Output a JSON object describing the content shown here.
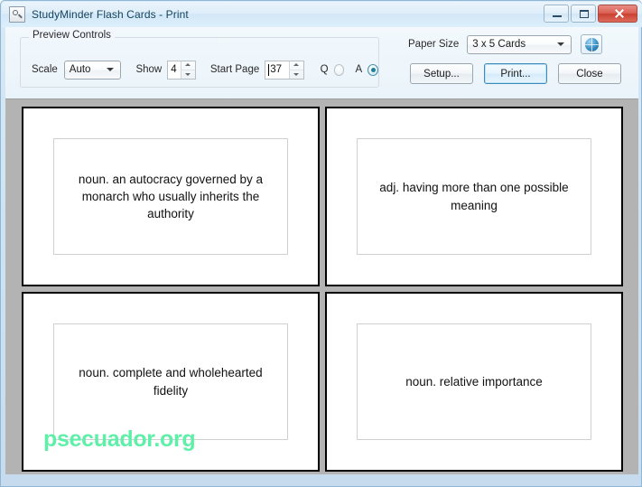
{
  "window": {
    "title": "StudyMinder Flash Cards - Print",
    "icon": "print-preview-icon",
    "controls": {
      "minimize": "Minimize",
      "maximize": "Maximize",
      "close": "Close"
    }
  },
  "toolbar": {
    "group_label": "Preview Controls",
    "scale_label": "Scale",
    "scale_value": "Auto",
    "show_label": "Show",
    "show_value": "4",
    "start_page_label": "Start Page",
    "start_page_value": "37",
    "q_label": "Q",
    "a_label": "A",
    "q_selected": false,
    "a_selected": true,
    "paper_size_label": "Paper Size",
    "paper_size_value": "3 x 5 Cards",
    "help_icon": "globe-help-icon",
    "setup_label": "Setup...",
    "print_label": "Print...",
    "close_label": "Close",
    "focused_button": "print"
  },
  "preview": {
    "cards": [
      {
        "text": "noun. an autocracy governed by a monarch who usually inherits the authority"
      },
      {
        "text": "adj. having more than one possible meaning"
      },
      {
        "text": "noun. complete and wholehearted fidelity"
      },
      {
        "text": "noun. relative importance"
      }
    ],
    "watermark": "psecuador.org"
  },
  "colors": {
    "accent": "#3c8bbd",
    "close_button": "#c9402f",
    "radio_on": "#1f7f96",
    "preview_bg": "#b3b3b3",
    "watermark": "#5ef0a8",
    "title_text": "#16435e"
  }
}
